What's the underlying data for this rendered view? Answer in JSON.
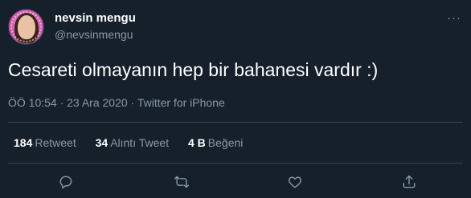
{
  "user": {
    "name": "nevsin mengu",
    "handle": "@nevsinmengu"
  },
  "tweet": {
    "text": "Cesareti olmayanın hep bir bahanesi vardır :)",
    "meta": "ÖÖ 10:54 · 23 Ara 2020 · Twitter for iPhone"
  },
  "stats": {
    "retweets": {
      "count": "184",
      "label": "Retweet"
    },
    "quotes": {
      "count": "34",
      "label": "Alıntı Tweet"
    },
    "likes": {
      "count": "4 B",
      "label": "Beğeni"
    }
  },
  "more_label": "···",
  "icons": {
    "reply": "reply-icon",
    "retweet": "retweet-icon",
    "like": "heart-icon",
    "share": "share-icon"
  },
  "colors": {
    "background": "#15202b",
    "text": "#ffffff",
    "secondary": "#8899a6",
    "divider": "#38444d"
  }
}
